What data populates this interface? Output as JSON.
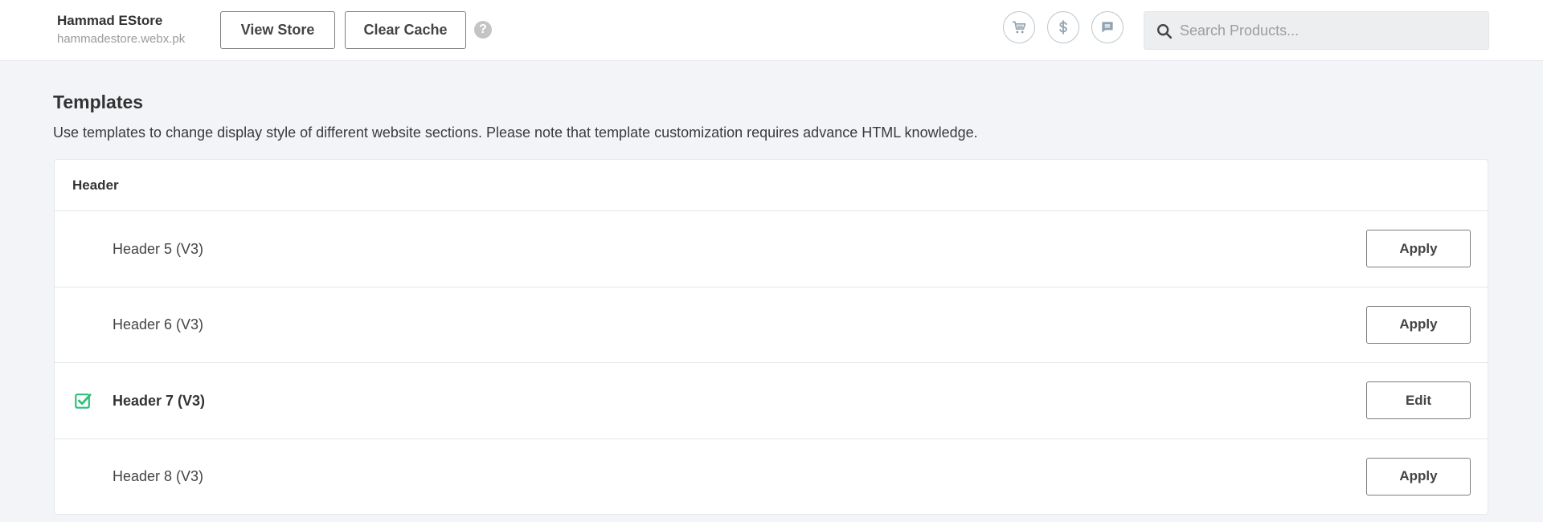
{
  "header": {
    "store_name": "Hammad EStore",
    "store_domain": "hammadestore.webx.pk",
    "view_store_label": "View Store",
    "clear_cache_label": "Clear Cache",
    "help_glyph": "?",
    "icons": [
      "cart-icon",
      "dollar-icon",
      "chat-icon"
    ],
    "search": {
      "placeholder": "Search Products...",
      "value": ""
    }
  },
  "main": {
    "title": "Templates",
    "description": "Use templates to change display style of different website sections. Please note that template customization requires advance HTML knowledge.",
    "section": {
      "title": "Header",
      "templates": [
        {
          "name": "Header 5 (V3)",
          "active": false,
          "action": "Apply"
        },
        {
          "name": "Header 6 (V3)",
          "active": false,
          "action": "Apply"
        },
        {
          "name": "Header 7 (V3)",
          "active": true,
          "action": "Edit"
        },
        {
          "name": "Header 8 (V3)",
          "active": false,
          "action": "Apply"
        }
      ]
    }
  },
  "colors": {
    "accent_check": "#2ebf7a",
    "icon_stroke": "#8fa3b3",
    "background": "#f3f4f8"
  }
}
